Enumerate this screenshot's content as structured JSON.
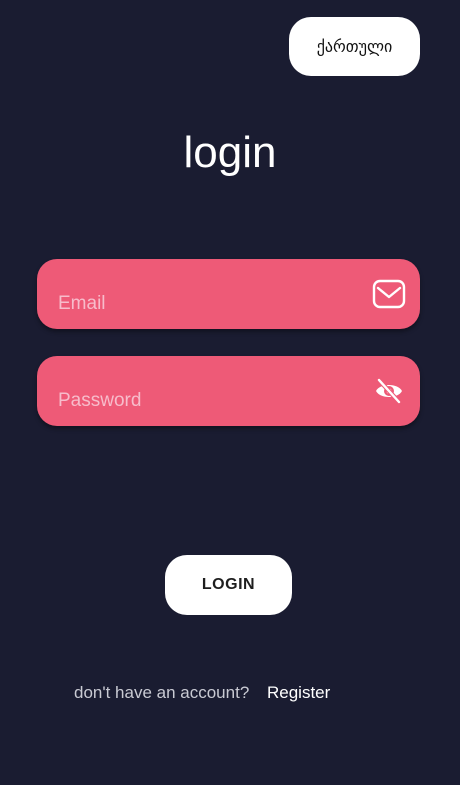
{
  "language_button": {
    "label": "ქართული"
  },
  "title": "login",
  "form": {
    "email": {
      "placeholder": "Email",
      "value": "",
      "icon": "mail-icon"
    },
    "password": {
      "placeholder": "Password",
      "value": "",
      "icon": "eye-off-icon"
    }
  },
  "login_button": {
    "label": "LOGIN"
  },
  "footer": {
    "prompt": "don't have an account?",
    "register_link": "Register"
  },
  "colors": {
    "background": "#1a1c31",
    "field": "#ee5a77",
    "placeholder": "#f7bccb",
    "button": "#ffffff"
  }
}
